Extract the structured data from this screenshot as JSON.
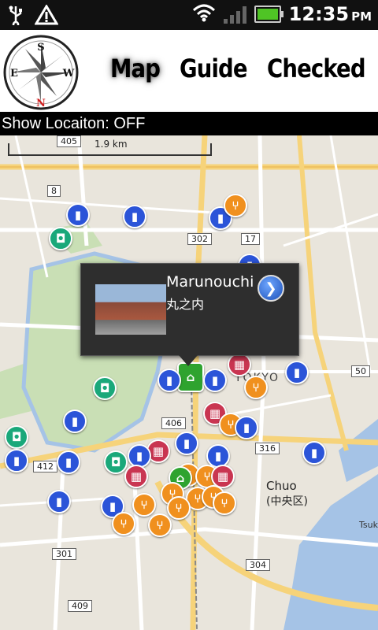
{
  "status_bar": {
    "time": "12:35",
    "ampm": "PM",
    "icons": [
      "usb-icon",
      "warning-icon",
      "wifi-icon",
      "signal-icon",
      "battery-icon"
    ]
  },
  "toolbar": {
    "compass_letters": {
      "north": "N",
      "south": "S",
      "east": "E",
      "west": "W"
    },
    "tabs": [
      {
        "label": "Map",
        "active": true
      },
      {
        "label": "Guide",
        "active": false
      },
      {
        "label": "Checked",
        "active": false
      }
    ]
  },
  "location_bar": {
    "text": "Show Locaiton: OFF"
  },
  "map": {
    "scale_label": "1.9 km",
    "road_shields": [
      "405",
      "8",
      "302",
      "17",
      "406",
      "412",
      "316",
      "301",
      "304",
      "409",
      "50"
    ],
    "district_labels": [
      "Chuo",
      "(中央区)",
      "TOKYO",
      "Tsuk"
    ],
    "popup": {
      "title": "Marunouchi",
      "subtitle": "丸之内",
      "action_icon": "chevron-right-icon"
    },
    "colors": {
      "train": "#2b54d8",
      "food": "#f0901e",
      "shop": "#c93551",
      "photo": "#1aa87a",
      "sight": "#2fa32f"
    }
  }
}
